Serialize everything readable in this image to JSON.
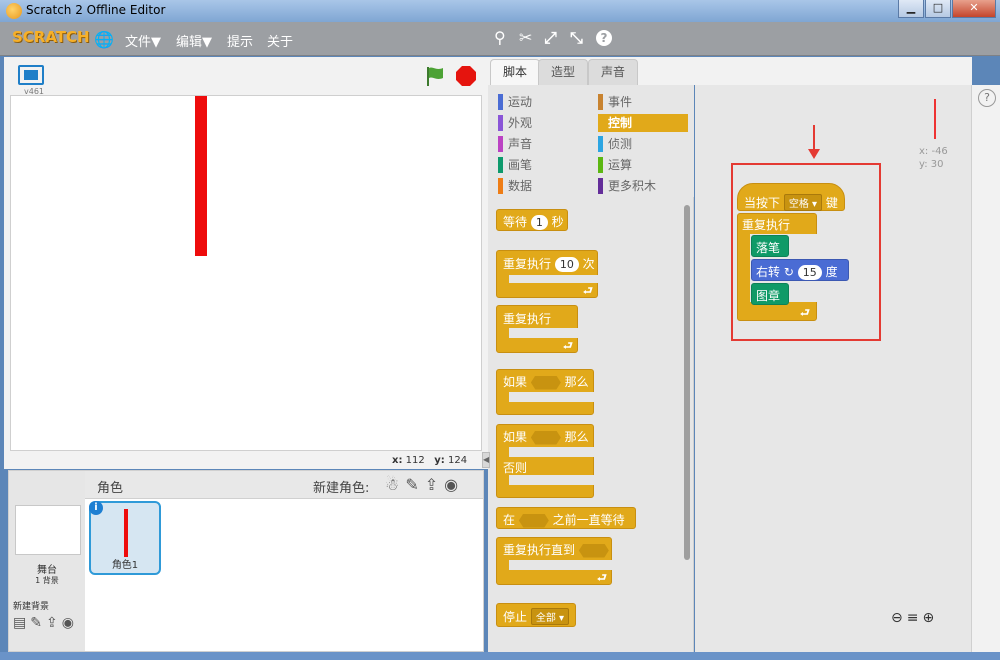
{
  "window": {
    "title": "Scratch 2 Offline Editor",
    "minimize": "▁",
    "maximize": "□",
    "close": "✕"
  },
  "menubar": {
    "logo": "SCRATCH",
    "items": [
      "文件▼",
      "编辑▼",
      "提示",
      "关于"
    ],
    "tools": [
      "duplicate-icon",
      "delete-icon",
      "grow-icon",
      "shrink-icon",
      "help-icon"
    ],
    "tool_glyphs": [
      "⚲",
      "✂",
      "⤢",
      "⤡",
      "?"
    ]
  },
  "stage": {
    "version": "v461",
    "coords": {
      "x_label": "x:",
      "x_value": "112",
      "y_label": "y:",
      "y_value": "124"
    }
  },
  "sprites": {
    "title": "角色",
    "new_sprite": "新建角色:",
    "stage_label": "舞台",
    "stage_sub": "1 背景",
    "new_backdrop": "新建背景",
    "sprite1_name": "角色1",
    "info": "i"
  },
  "tabs": [
    "脚本",
    "造型",
    "声音"
  ],
  "categories": [
    {
      "label": "运动",
      "color": "#4a6cd4"
    },
    {
      "label": "事件",
      "color": "#c88330"
    },
    {
      "label": "外观",
      "color": "#8a55d7"
    },
    {
      "label": "控制",
      "color": "#e1a91a"
    },
    {
      "label": "声音",
      "color": "#bb42c3"
    },
    {
      "label": "侦测",
      "color": "#2ca5e2"
    },
    {
      "label": "画笔",
      "color": "#0e9a6c"
    },
    {
      "label": "运算",
      "color": "#5cb712"
    },
    {
      "label": "数据",
      "color": "#ee7d16"
    },
    {
      "label": "更多积木",
      "color": "#632d99"
    }
  ],
  "palette_blocks": {
    "wait": {
      "label": "等待",
      "value": "1",
      "unit": "秒"
    },
    "repeat": {
      "label": "重复执行",
      "value": "10",
      "unit": "次"
    },
    "forever": {
      "label": "重复执行"
    },
    "if_then": {
      "label": "如果",
      "then": "那么"
    },
    "if_else": {
      "label": "如果",
      "then": "那么",
      "else": "否则"
    },
    "wait_until": {
      "pre": "在",
      "post": "之前一直等待"
    },
    "repeat_until": {
      "label": "重复执行直到"
    },
    "stop": {
      "label": "停止",
      "option": "全部"
    }
  },
  "script": {
    "hat": {
      "pre": "当按下",
      "key": "空格",
      "post": "键"
    },
    "forever": "重复执行",
    "pen_down": "落笔",
    "turn": {
      "label": "右转",
      "value": "15",
      "unit": "度"
    },
    "stamp": "图章"
  },
  "sprite_info": {
    "x": "x: -46",
    "y": "y: 30"
  },
  "zoom": [
    "zoom-out-icon",
    "zoom-reset-icon",
    "zoom-in-icon"
  ]
}
